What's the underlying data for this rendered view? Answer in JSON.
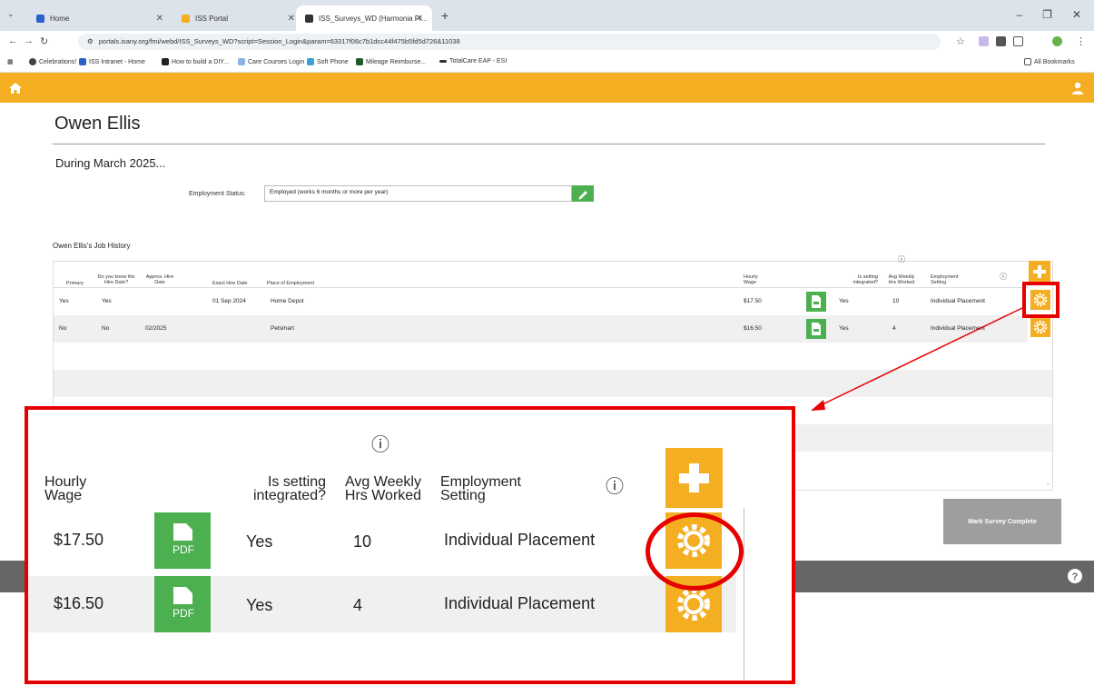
{
  "browser": {
    "tabs": [
      {
        "label": "Home",
        "active": false
      },
      {
        "label": "ISS Portal",
        "active": false
      },
      {
        "label": "ISS_Surveys_WD (Harmonia Fr...",
        "active": true
      }
    ],
    "url": "portals.isany.org/fmi/webd/ISS_Surveys_WD?script=Session_Login&param=63317f06c7b1dcc44f475b5fd5d726&11038",
    "bookmarks": [
      "Celebrations!",
      "ISS Intranet - Home",
      "How to build a DIY...",
      "Care Courses Login",
      "Soft Phone",
      "Mileage Reimburse...",
      "TotalCare EAP - ESI"
    ],
    "all_bookmarks": "All Bookmarks"
  },
  "colors": {
    "accent": "#f3ae22",
    "green": "#4caf50",
    "highlight": "#e60000",
    "footer": "#666666"
  },
  "page": {
    "name": "Owen Ellis",
    "period": "During March 2025...",
    "employment_label": "Employment Status:",
    "employment_value": "Employed (works 6 months or more per year)",
    "history_title": "Owen Ellis's Job History"
  },
  "table": {
    "headers": {
      "primary": "Primary",
      "know_hire": "Do you know the Hire Date?",
      "approx_hire": "Approx. Hire Date",
      "exact_hire": "Exact Hire Date",
      "place": "Place of Employment",
      "wage": "Hourly Wage",
      "integrated": "Is setting integrated?",
      "hours": "Avg Weekly Hrs Worked",
      "setting": "Employment Setting",
      "info_icon": "ⓘ"
    },
    "rows": [
      {
        "primary": "Yes",
        "know": "Yes",
        "approx": "",
        "exact": "01 Sep 2024",
        "place": "Home Depot",
        "wage": "$17.50",
        "integrated": "Yes",
        "hours": "10",
        "setting": "Individual Placement"
      },
      {
        "primary": "No",
        "know": "No",
        "approx": "02/2025",
        "exact": "",
        "place": "Petsmart",
        "wage": "$16.50",
        "integrated": "Yes",
        "hours": "4",
        "setting": "Individual Placement"
      }
    ]
  },
  "complete_button": "Mark Survey Complete",
  "zoom": {
    "info": "ⓘ",
    "headers": {
      "wage": "Hourly Wage",
      "integrated": "Is setting integrated?",
      "hours": "Avg Weekly Hrs Worked",
      "setting": "Employment Setting"
    },
    "pdf_label": "PDF"
  }
}
